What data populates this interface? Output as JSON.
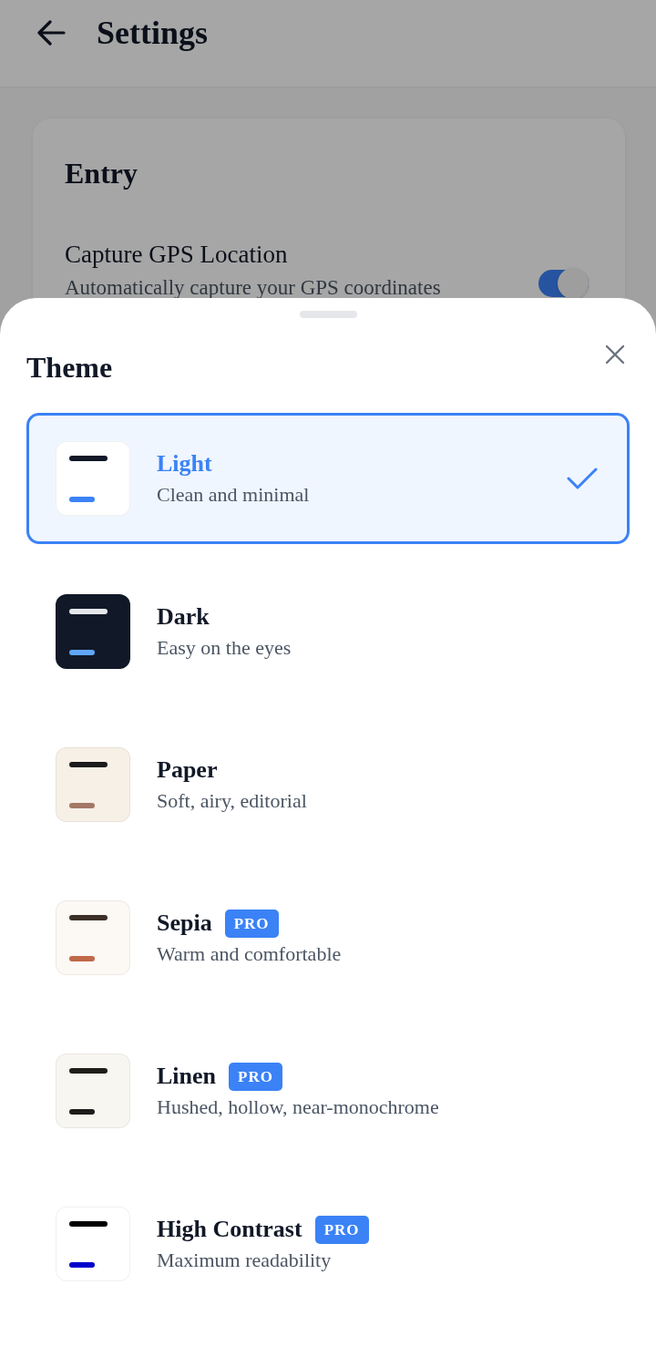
{
  "header": {
    "title": "Settings"
  },
  "section": {
    "title": "Entry",
    "settings": [
      {
        "label": "Capture GPS Location",
        "description": "Automatically capture your GPS coordinates",
        "on": true
      }
    ]
  },
  "sheet": {
    "title": "Theme",
    "options": [
      {
        "name": "Light",
        "description": "Clean and minimal",
        "selected": true,
        "preview": {
          "color": "#ffffff",
          "lines": [
            {
              "color": "#111827"
            },
            {
              "color": "#3b82f6"
            }
          ]
        }
      },
      {
        "name": "Dark",
        "description": "Easy on the eyes",
        "selected": false,
        "preview": {
          "color": "#111827",
          "lines": [
            {
              "color": "#e5e7eb"
            },
            {
              "color": "#60a5fa"
            }
          ]
        }
      },
      {
        "name": "Paper",
        "description": "Soft, airy, editorial",
        "selected": false,
        "preview": {
          "color": "#f7f0e6",
          "lines": [
            {
              "color": "#1c1c1c"
            },
            {
              "color": "#a47866"
            }
          ]
        }
      },
      {
        "name": "Sepia",
        "description": "Warm and comfortable",
        "selected": false,
        "badge": "PRO",
        "preview": {
          "color": "#fcf8f4",
          "lines": [
            {
              "color": "#3d3029"
            },
            {
              "color": "#c0684a"
            }
          ]
        }
      },
      {
        "name": "Linen",
        "description": "Hushed, hollow, near-monochrome",
        "selected": false,
        "badge": "PRO",
        "preview": {
          "color": "#f8f6f0",
          "lines": [
            {
              "color": "#1f1d1a"
            },
            {
              "color": "#1f1d1a"
            }
          ]
        }
      },
      {
        "name": "High Contrast",
        "description": "Maximum readability",
        "selected": false,
        "badge": "PRO",
        "preview": {
          "color": "#ffffff",
          "lines": [
            {
              "color": "#000000"
            },
            {
              "color": "#0000cc"
            }
          ]
        }
      }
    ]
  }
}
